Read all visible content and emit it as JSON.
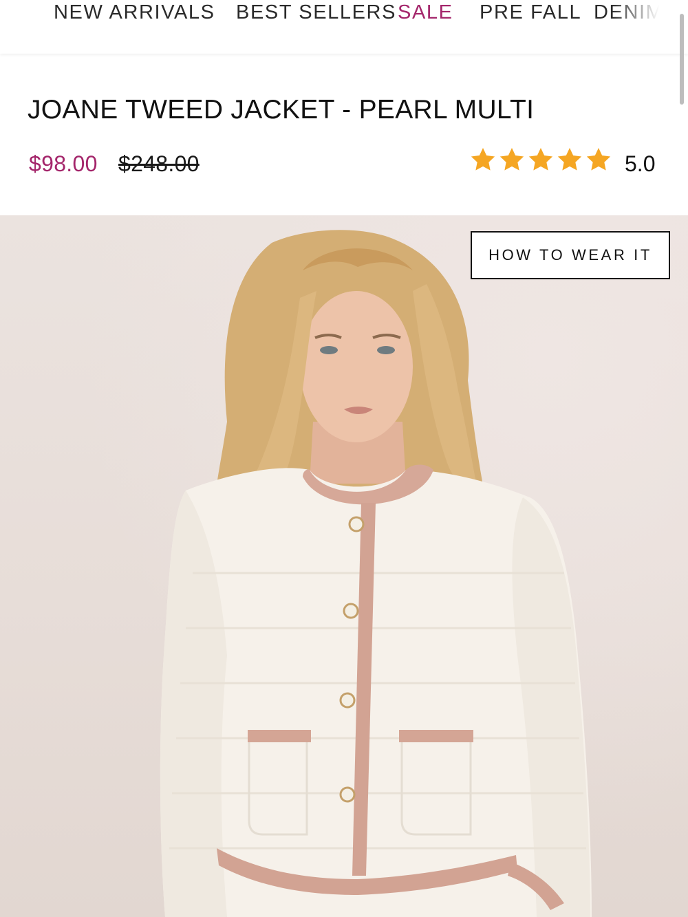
{
  "nav": {
    "items": [
      {
        "label": "NEW ARRIVALS"
      },
      {
        "label": "BEST SELLERS"
      },
      {
        "label": "SALE"
      },
      {
        "label": "PRE FALL"
      },
      {
        "label": "DENIM"
      }
    ]
  },
  "product": {
    "title": "JOANE TWEED JACKET - PEARL MULTI",
    "sale_price": "$98.00",
    "original_price": "$248.00",
    "rating": "5.0",
    "stars": 5
  },
  "hero": {
    "how_to_wear_label": "HOW TO WEAR IT"
  },
  "colors": {
    "accent": "#a4266b",
    "star": "#f5a623"
  },
  "icons": [
    "star-icon"
  ]
}
